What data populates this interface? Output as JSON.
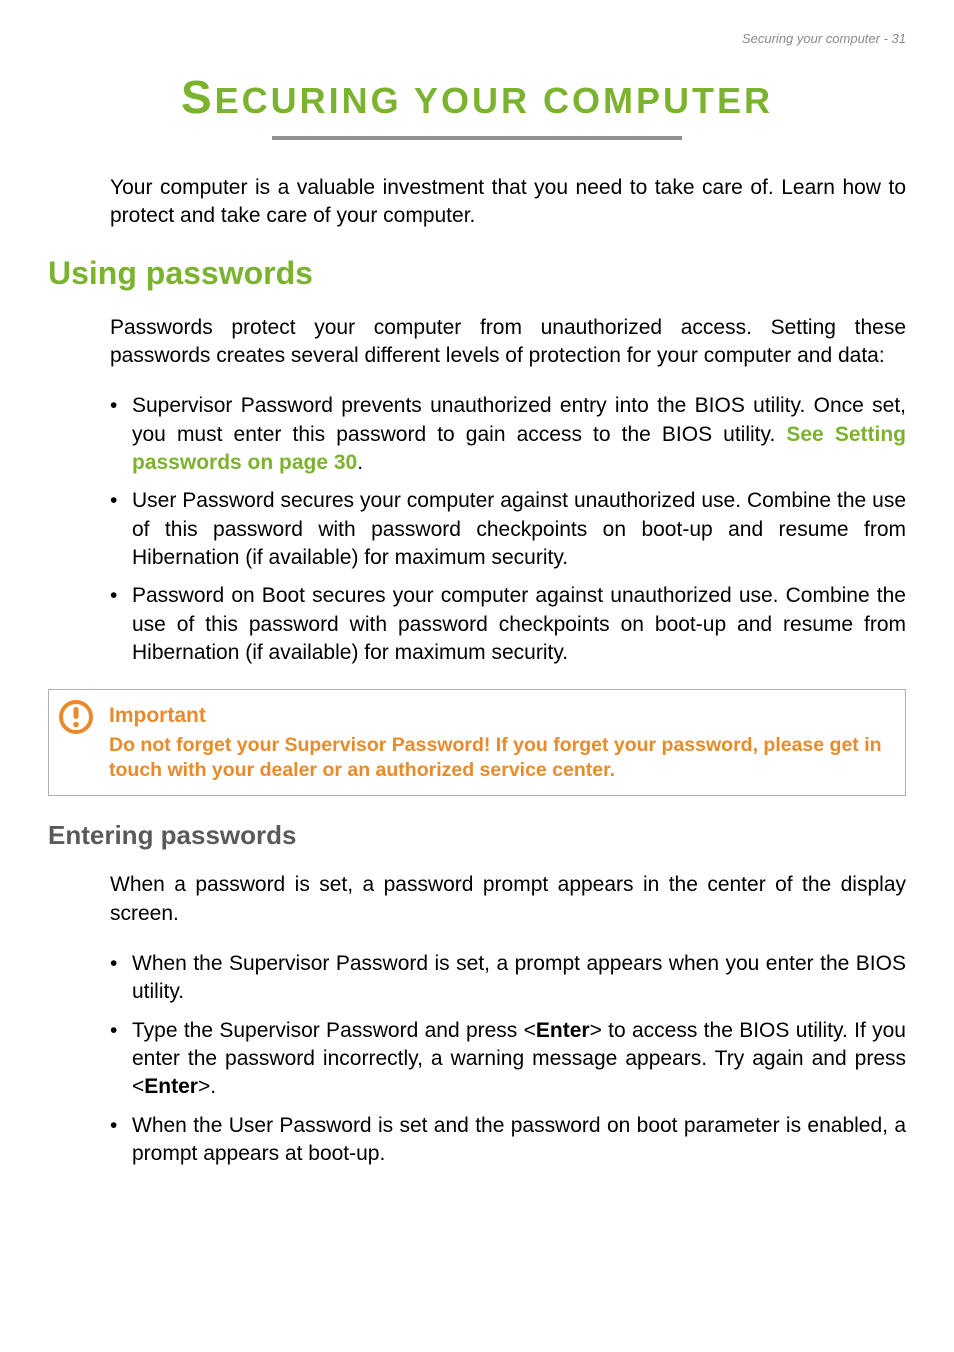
{
  "header": {
    "running": "Securing your computer - 31"
  },
  "title": {
    "first": "S",
    "rest": "ECURING YOUR COMPUTER"
  },
  "intro": "Your computer is a valuable investment that you need to take care of. Learn how to protect and take care of your computer.",
  "section1": {
    "heading": "Using passwords",
    "para": "Passwords protect your computer from unauthorized access. Setting these passwords creates several different levels of protection for your computer and data:",
    "bullets": {
      "b1a": "Supervisor Password prevents unauthorized entry into the BIOS utility. Once set, you must enter this password to gain access to the BIOS utility. ",
      "b1link": "See Setting passwords on page 30",
      "b1b": ".",
      "b2": "User Password secures your computer against unauthorized use. Combine the use of this password with password checkpoints on boot-up and resume from Hibernation (if available) for maximum security.",
      "b3": "Password on Boot secures your computer against unauthorized use. Combine the use of this password with password checkpoints on boot-up and resume from Hibernation (if available) for maximum security."
    }
  },
  "callout": {
    "title": "Important",
    "body": "Do not forget your Supervisor Password! If you forget your password, please get in touch with your dealer or an authorized service center."
  },
  "section2": {
    "heading": "Entering passwords",
    "para": "When a password is set, a password prompt appears in the center of the display screen.",
    "bullets": {
      "b1": "When the Supervisor Password is set, a prompt appears when you enter the BIOS utility.",
      "b2a": "Type the Supervisor Password and press <",
      "b2enter1": "Enter",
      "b2b": "> to access the BIOS utility. If you enter the password incorrectly, a warning message appears. Try again and press <",
      "b2enter2": "Enter",
      "b2c": ">.",
      "b3": "When the User Password is set and the password on boot parameter is enabled, a prompt appears at boot-up."
    }
  }
}
